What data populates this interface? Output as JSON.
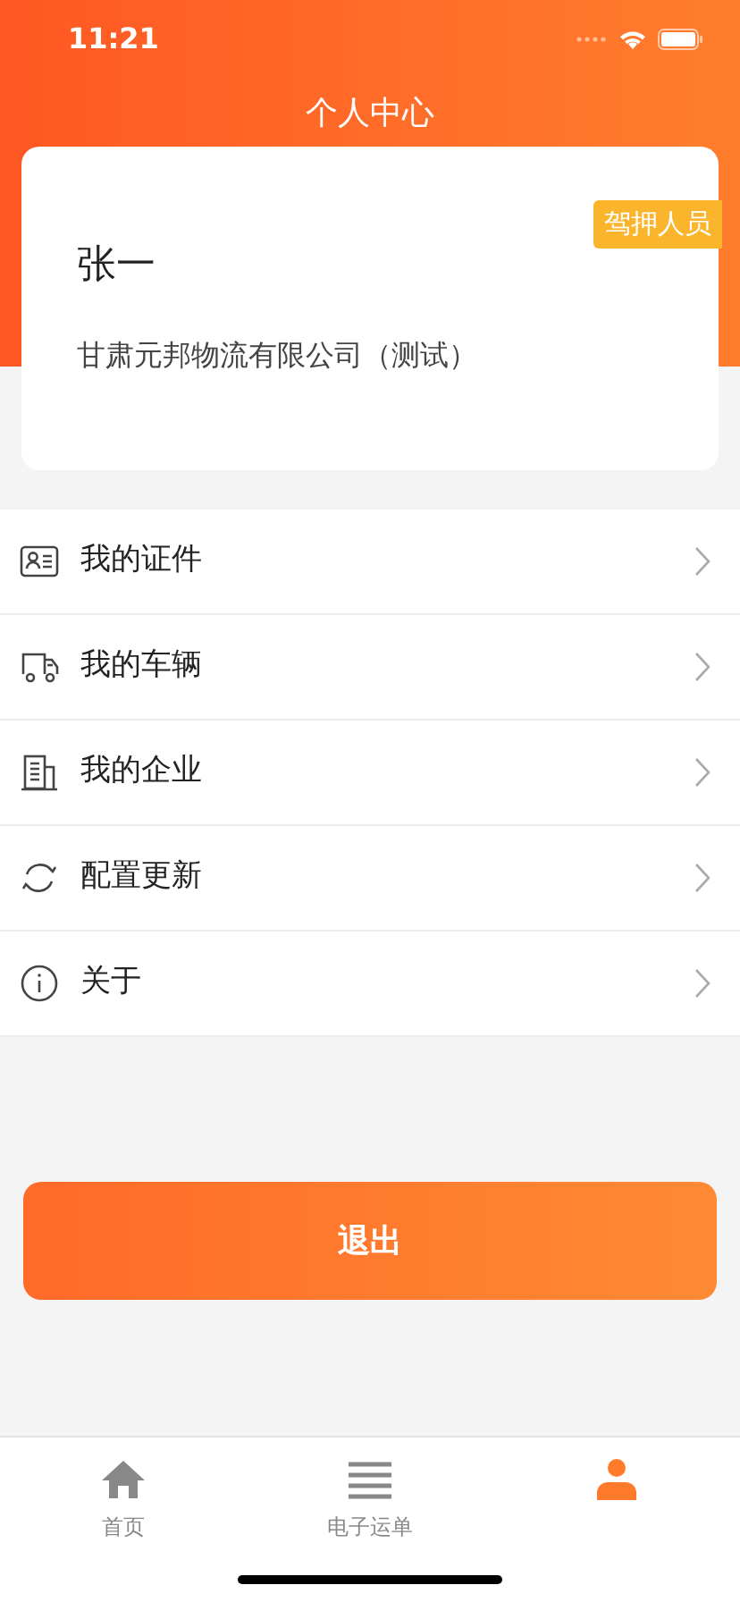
{
  "status_bar": {
    "time": "11:21"
  },
  "header": {
    "title": "个人中心"
  },
  "profile": {
    "name": "张一",
    "company": "甘肃元邦物流有限公司（测试）",
    "badge": "驾押人员"
  },
  "menu": [
    {
      "kind": "id-card",
      "label": "我的证件"
    },
    {
      "kind": "truck",
      "label": "我的车辆"
    },
    {
      "kind": "building",
      "label": "我的企业"
    },
    {
      "kind": "refresh",
      "label": "配置更新"
    },
    {
      "kind": "info",
      "label": "关于"
    }
  ],
  "logout_button": "退出",
  "tab_bar": [
    {
      "kind": "home",
      "label": "首页",
      "selected": false
    },
    {
      "kind": "list",
      "label": "电子运单",
      "selected": false
    },
    {
      "kind": "person",
      "selected": true
    }
  ]
}
